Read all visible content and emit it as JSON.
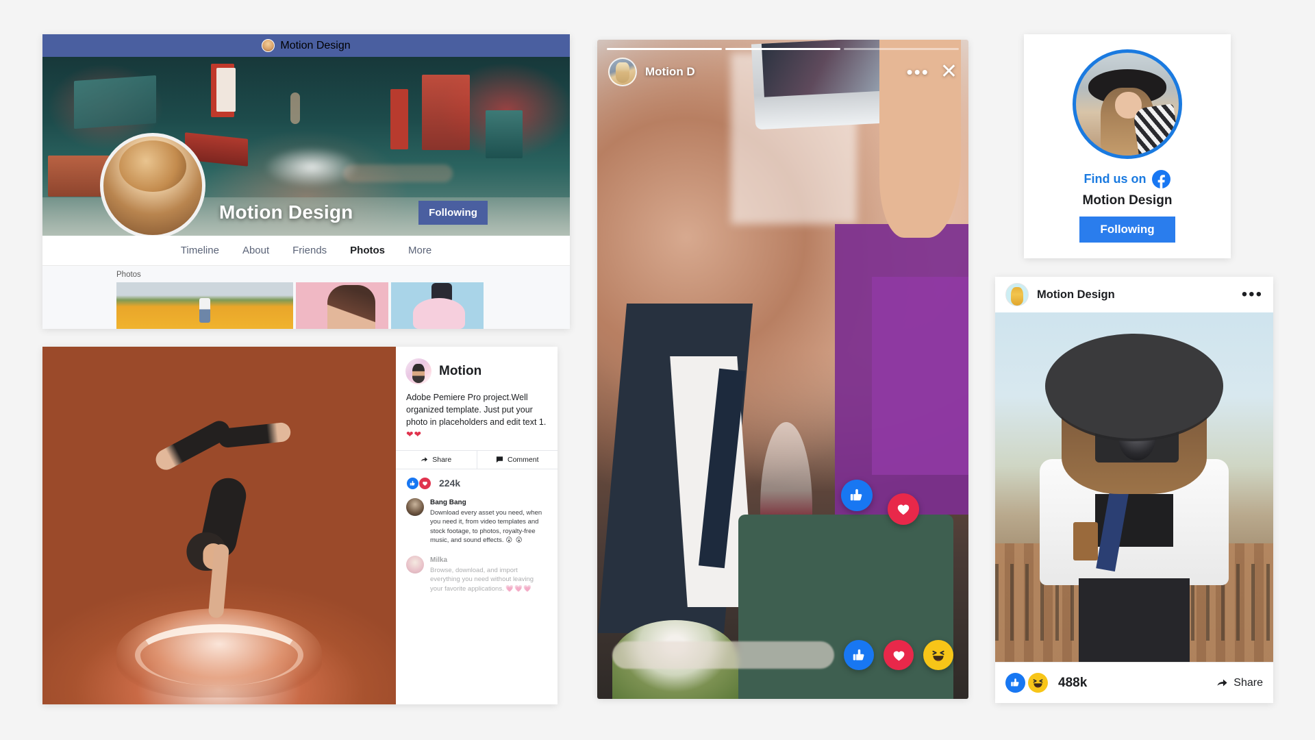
{
  "meta": {
    "background_color": "#f4f4f4",
    "brand_name": "Motion Design",
    "accent_blue": "#1877f2",
    "accent_indigo": "#4a5fa0",
    "accent_red": "#e0334d",
    "accent_yellow": "#f7c518"
  },
  "profile_card": {
    "topbar": {
      "title": "Motion Design",
      "avatar_icon": "woman-avatar-icon"
    },
    "cover": {
      "name": "Motion Design",
      "follow_label": "Following",
      "avatar_icon": "curly-hair-woman-avatar-icon"
    },
    "nav": [
      {
        "label": "Timeline",
        "active": false
      },
      {
        "label": "About",
        "active": false
      },
      {
        "label": "Friends",
        "active": false
      },
      {
        "label": "Photos",
        "active": true
      },
      {
        "label": "More",
        "active": false
      }
    ],
    "photos": {
      "label": "Photos",
      "thumbs": [
        {
          "alt": "marigold-field-photo"
        },
        {
          "alt": "pink-background-portrait-photo"
        },
        {
          "alt": "blue-background-pink-dress-photo"
        }
      ]
    }
  },
  "post_card": {
    "media_alt": "handstand-dancer-water-splash-photo",
    "author": {
      "name": "Motion",
      "avatar_icon": "man-sunglasses-avatar-icon"
    },
    "body_text": "Adobe Pemiere Pro project.Well organized template. Just put your photo in placeholders and edit text 1. ",
    "body_hearts": "❤❤",
    "actions": {
      "share_label": "Share",
      "share_icon": "share-arrow-icon",
      "comment_label": "Comment",
      "comment_icon": "comment-bubble-icon"
    },
    "reactions": {
      "count": "224k",
      "like_icon": "thumbs-up-icon",
      "love_icon": "heart-icon"
    },
    "comments": [
      {
        "name": "Bang Bang",
        "text": "Download every asset you need, when you need it, from video templates and stock footage, to photos, royalty-free music, and sound effects. ",
        "emoji": "😮 😮",
        "avatar_icon": "bang-bang-avatar-icon",
        "faded": false
      },
      {
        "name": "Milka",
        "text": "Browse, download, and import everything you need without leaving your favorite applications. ",
        "emoji": "💗💗💗",
        "avatar_icon": "milka-avatar-icon",
        "faded": true
      }
    ]
  },
  "story_card": {
    "media_alt": "couple-kissing-restaurant-photo",
    "progress_segments": [
      true,
      true,
      false
    ],
    "header": {
      "name": "Motion D",
      "avatar_icon": "blonde-woman-avatar-icon",
      "menu_icon": "more-options-icon",
      "close_icon": "close-x-icon"
    },
    "floating_reactions": [
      {
        "icon": "thumbs-up-icon",
        "type": "like"
      },
      {
        "icon": "heart-icon",
        "type": "love"
      }
    ],
    "reply": {
      "placeholder": ""
    },
    "bottom_reactions": [
      {
        "icon": "thumbs-up-icon",
        "type": "like"
      },
      {
        "icon": "heart-icon",
        "type": "love"
      },
      {
        "icon": "haha-face-icon",
        "type": "haha"
      }
    ]
  },
  "findus_card": {
    "avatar_icon": "hat-woman-avatar-icon",
    "find_text": "Find us on",
    "facebook_icon": "facebook-f-icon",
    "name": "Motion Design",
    "follow_label": "Following"
  },
  "feed_card": {
    "header": {
      "name": "Motion Design",
      "avatar_icon": "yellow-raincoat-avatar-icon",
      "menu_icon": "more-options-icon"
    },
    "media_alt": "woman-with-camera-and-hat-photo",
    "footer": {
      "like_icon": "thumbs-up-icon",
      "haha_icon": "haha-face-icon",
      "count": "488k",
      "share_label": "Share",
      "share_icon": "share-arrow-icon"
    }
  }
}
